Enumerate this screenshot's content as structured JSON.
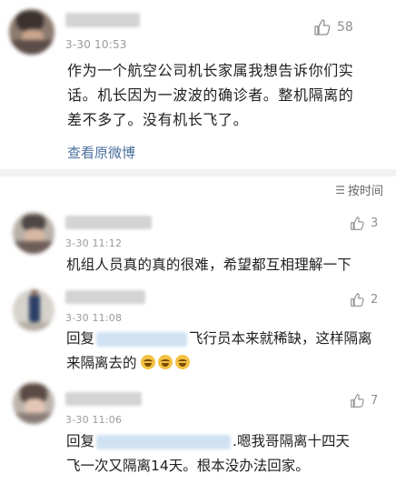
{
  "top_comment": {
    "timestamp": "3-30 10:53",
    "likes": "58",
    "text_lines": [
      "作为一个航空公司机长家属我想告诉你们实",
      "话。机长因为一波波的确诊者。整机隔离的",
      "差不多了。没有机长飞了。"
    ],
    "view_original_label": "查看原微博"
  },
  "sort": {
    "label": "按时间",
    "icon": "sort-icon"
  },
  "replies": [
    {
      "timestamp": "3-30 11:12",
      "likes": "3",
      "text": "机组人员真的真的很难，希望都互相理解一下"
    },
    {
      "timestamp": "3-30 11:08",
      "likes": "2",
      "reply_prefix": "回复",
      "line1_rest": "飞行员本来就稀缺，这样隔离",
      "line2": "来隔离去的",
      "emoji_icons": [
        "laugh-cry-emoji",
        "laugh-cry-emoji",
        "laugh-cry-emoji"
      ]
    },
    {
      "timestamp": "3-30 11:06",
      "likes": "7",
      "reply_prefix": "回复",
      "line1_rest": ".嗯我哥隔离十四天",
      "line2": "飞一次又隔离14天。根本没办法回家。"
    }
  ],
  "colors": {
    "link": "#4a6f9c",
    "mention_blur": "#cfe1f2",
    "divider": "#f2f2f2"
  }
}
